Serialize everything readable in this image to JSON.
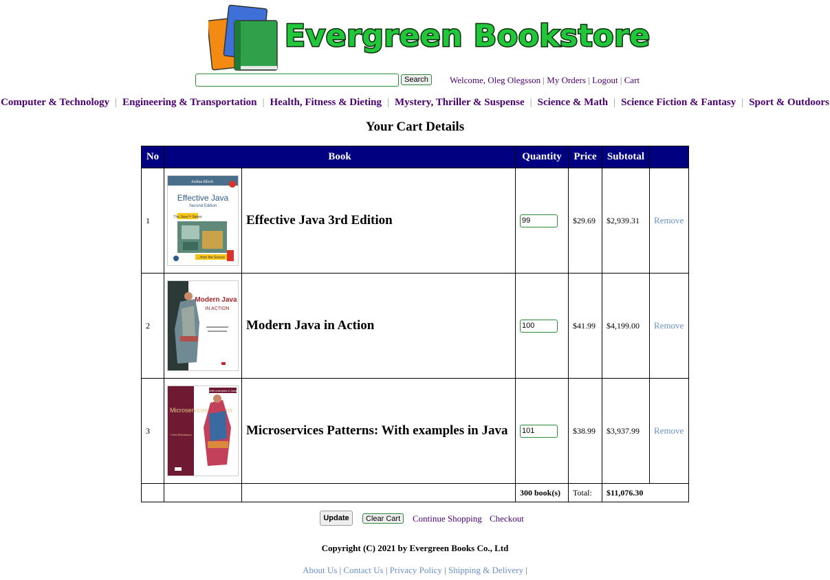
{
  "header": {
    "store_name": "Evergreen Bookstore"
  },
  "search": {
    "button_label": "Search",
    "value": ""
  },
  "user_nav": {
    "welcome": "Welcome, Oleg Olegsson",
    "my_orders": "My Orders",
    "logout": "Logout",
    "cart": "Cart"
  },
  "categories": [
    "Computer & Technology",
    "Engineering & Transportation",
    "Health, Fitness & Dieting",
    "Mystery, Thriller & Suspense",
    "Science & Math",
    "Science Fiction & Fantasy",
    "Sport & Outdoors"
  ],
  "page_title": "Your Cart Details",
  "table": {
    "headers": {
      "no": "No",
      "book": "Book",
      "quantity": "Quantity",
      "price": "Price",
      "subtotal": "Subtotal"
    },
    "rows": [
      {
        "no": "1",
        "title": "Effective Java 3rd Edition",
        "quantity": "99",
        "price": "$29.69",
        "subtotal": "$2,939.31",
        "remove": "Remove",
        "cover": {
          "author": "Joshua Bloch",
          "title": "Effective Java",
          "subtitle": "Second Edition",
          "series": "The Java™ Series",
          "tagline": "...from the Source"
        }
      },
      {
        "no": "2",
        "title": "Modern Java in Action",
        "quantity": "100",
        "price": "$41.99",
        "subtotal": "$4,199.00",
        "remove": "Remove",
        "cover": {
          "title": "Modern Java",
          "subtitle": "IN ACTION"
        }
      },
      {
        "no": "3",
        "title": "Microservices Patterns: With examples in Java",
        "quantity": "101",
        "price": "$38.99",
        "subtotal": "$3,937.99",
        "remove": "Remove",
        "cover": {
          "title": "Microservices Patterns",
          "author": "Chris Richardson",
          "tag": "With examples in Java"
        }
      }
    ],
    "totals": {
      "books": "300 book(s)",
      "label": "Total:",
      "amount": "$11,076.30"
    }
  },
  "actions": {
    "update": "Update",
    "clear_cart": "Clear Cart",
    "continue_shopping": "Continue Shopping",
    "checkout": "Checkout"
  },
  "copyright": "Copyright (C) 2021 by Evergreen Books Co., Ltd",
  "footer": {
    "links": [
      "About Us",
      "Contact Us",
      "Privacy Policy",
      "Shipping & Delivery"
    ]
  },
  "colors": {
    "header_bg": "#000080",
    "link_purple": "#4b0070",
    "link_blue": "#6a8fc7",
    "logo_green": "#21c63a"
  }
}
